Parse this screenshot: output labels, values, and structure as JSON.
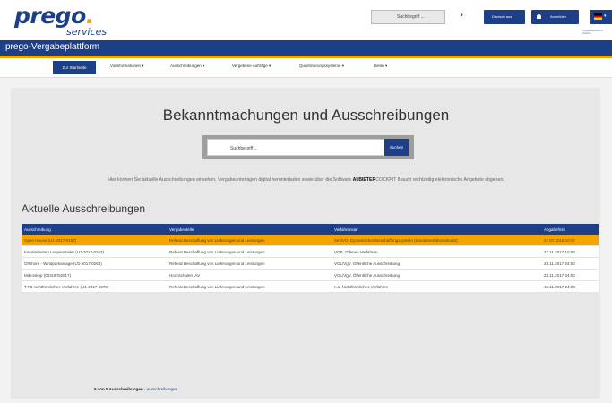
{
  "logo": {
    "main": "prego",
    "dot": ".",
    "sub": "services"
  },
  "header": {
    "search_placeholder": "Suchbegriff ...",
    "chevron": "›",
    "language_button": "Deutsch aus",
    "login_button": "Anmelden",
    "flag_caret": "▾",
    "partner_text": "Vergabeplattform Partner"
  },
  "platform": {
    "title": "prego-Vergabeplattform"
  },
  "nav": {
    "items": [
      "Zur Startseite",
      "Vorinformationen ▾",
      "Ausschreibungen ▾",
      "Vergebene Aufträge ▾",
      "Qualifizierungssysteme ▾",
      "Bieter ▾"
    ]
  },
  "main": {
    "heading": "Bekanntmachungen und Ausschreibungen",
    "search_placeholder": "Suchbegriff ...",
    "search_button": "Suchen",
    "info_pre": "Hier können Sie aktuelle Ausschreibungen einsehen, Vergabeunterlagen digital herunterladen sowie über die Software",
    "info_bold": "AI BIETER",
    "info_post": "COCKPIT 8 auch rechtzeitig elektronische Angebote abgeben.",
    "section_title": "Aktuelle Ausschreibungen"
  },
  "table": {
    "headers": [
      "Ausschreibung",
      "Vergabestelle",
      "Verfahrensart",
      "Abgabefrist"
    ],
    "rows": [
      [
        "Open House (U1-2017-0157)",
        "Referat Beschaffung von Lieferungen und Leistungen",
        "SektVO, Dynamisches Beschaffungssystem (Sonderverfahrenskontr)",
        "27.07.2018 10:07"
      ],
      [
        "Kanalarbeiten Leupenstieler (U1-2017-0263)",
        "Referat Beschaffung von Lieferungen und Leistungen",
        "VOB, Offenes Verfahren",
        "27.11.2017 10:00"
      ],
      [
        "Offshore - Windparkanlage (U1-2017-0264)",
        "Referat Beschaffung von Lieferungen und Leistungen",
        "VOL/VgV, Öffentliche Ausschreibung",
        "23.11.2017 24:00"
      ],
      [
        "Mikroskop (003UF/02017)",
        "Hochschulen IAV",
        "VOL/VgV, Öffentliche Ausschreibung",
        "23.11.2017 24:00"
      ],
      [
        "T-F2 nichtförmliches Verfahren (U1-2017-0278)",
        "Referat Beschaffung von Lieferungen und Leistungen",
        "n.a. Nichtförmliches Verfahren",
        "15.11.2017 24:00"
      ]
    ]
  },
  "footer": {
    "count": "5 von 5 Ausschreibungen",
    "separator": " - ",
    "link": "Ausschreibungen"
  },
  "colors": {
    "brand": "#1d3f87",
    "accent": "#f5a500"
  }
}
